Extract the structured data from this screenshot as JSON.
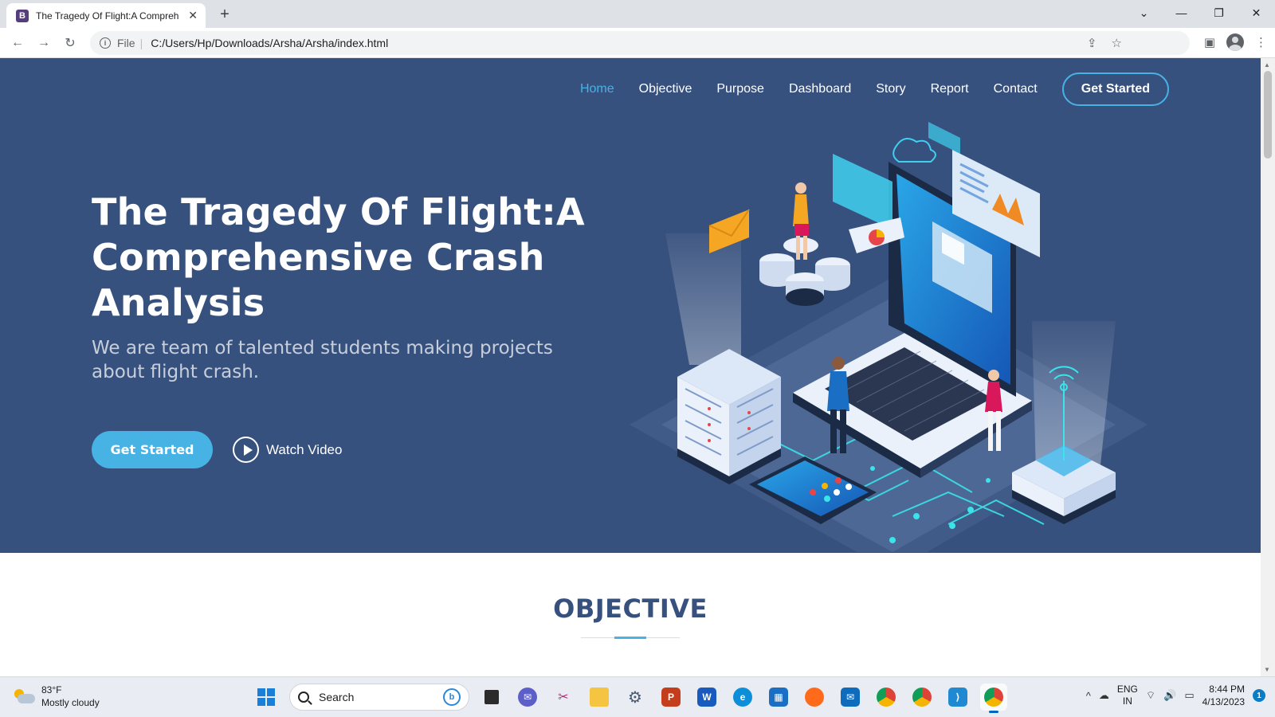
{
  "browser": {
    "tab_title": "The Tragedy Of Flight:A Compreh",
    "favicon_letter": "B",
    "url_scheme": "File",
    "url": "C:/Users/Hp/Downloads/Arsha/Arsha/index.html",
    "window_controls": [
      "minimize",
      "restore",
      "close"
    ]
  },
  "site_nav": {
    "items": [
      {
        "label": "Home",
        "active": true
      },
      {
        "label": "Objective",
        "active": false
      },
      {
        "label": "Purpose",
        "active": false
      },
      {
        "label": "Dashboard",
        "active": false
      },
      {
        "label": "Story",
        "active": false
      },
      {
        "label": "Report",
        "active": false
      },
      {
        "label": "Contact",
        "active": false
      }
    ],
    "cta_label": "Get Started"
  },
  "hero": {
    "title": "The Tragedy Of Flight:A Comprehensive Crash Analysis",
    "subtitle": "We are team of talented students making projects about flight crash.",
    "cta_label": "Get Started",
    "video_label": "Watch Video"
  },
  "sections": {
    "objective_title": "OBJECTIVE"
  },
  "taskbar": {
    "weather_temp": "83°F",
    "weather_desc": "Mostly cloudy",
    "search_placeholder": "Search",
    "lang_top": "ENG",
    "lang_bottom": "IN",
    "time": "8:44 PM",
    "date": "4/13/2023",
    "notification_count": "1",
    "apps": [
      "teams-chat",
      "snipping-tool",
      "file-explorer",
      "settings",
      "powerpoint",
      "word",
      "edge",
      "microsoft-store",
      "firefox",
      "mail",
      "chrome",
      "chrome-profile",
      "vscode",
      "chrome-active"
    ]
  },
  "colors": {
    "hero_bg": "#37517e",
    "accent": "#47b2e4",
    "title_dark": "#37517e"
  }
}
